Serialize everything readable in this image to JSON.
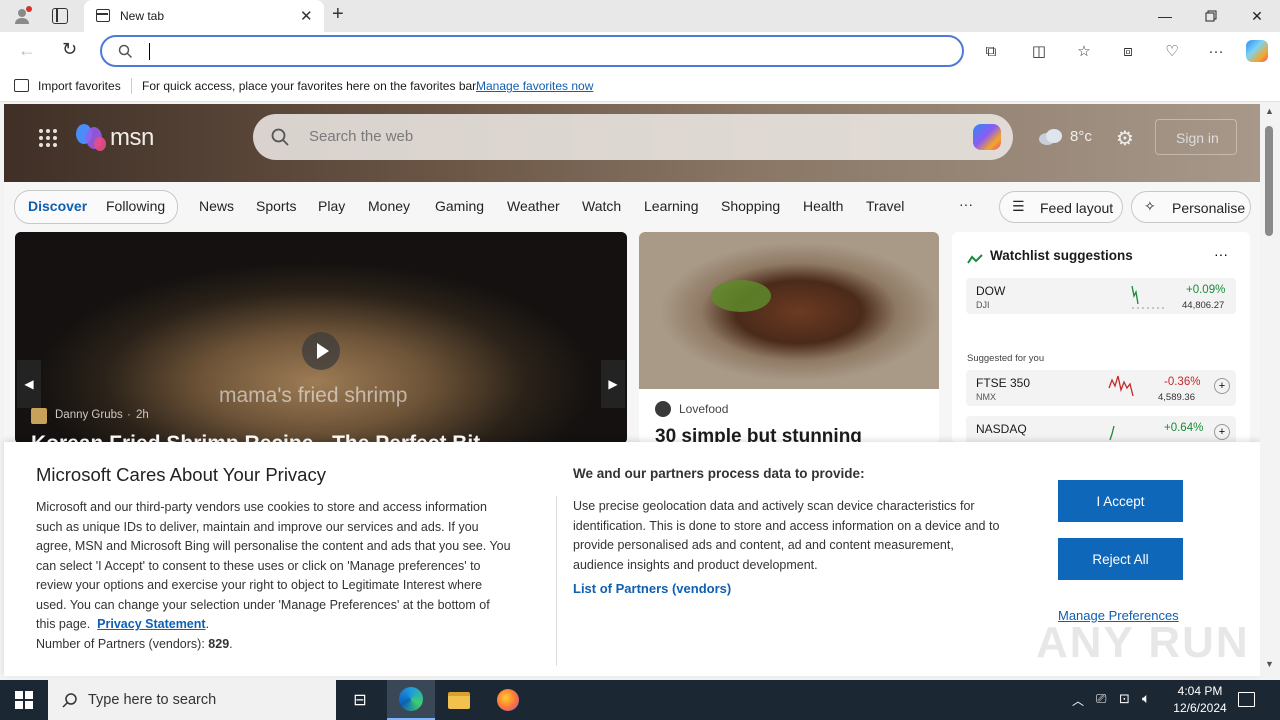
{
  "browser": {
    "tab_title": "New tab",
    "address_value": "",
    "favorites_bar": {
      "import_label": "Import favorites",
      "message": "For quick access, place your favorites here on the favorites bar.",
      "manage_link": "Manage favorites now"
    }
  },
  "msn": {
    "logo": "msn",
    "search_placeholder": "Search the web",
    "temperature": "8°c",
    "sign_in": "Sign in",
    "tabs": [
      "Discover",
      "Following"
    ],
    "nav": [
      "News",
      "Sports",
      "Play",
      "Money",
      "Gaming",
      "Weather",
      "Watch",
      "Learning",
      "Shopping",
      "Health",
      "Travel"
    ],
    "more": "···",
    "feed_layout": "Feed layout",
    "personalise": "Personalise",
    "hero": {
      "overlay_text": "mama's fried shrimp",
      "author": "Danny Grubs",
      "age": "2h",
      "headline": "Korean Fried Shrimp Recipe - The Perfect Bit"
    },
    "food_card": {
      "source": "Lovefood",
      "headline": "30 simple but stunning"
    },
    "watchlist": {
      "title": "Watchlist suggestions",
      "menu": "···",
      "suggested_label": "Suggested for you",
      "items": [
        {
          "name": "DOW",
          "sub": "DJI",
          "change": "+0.09%",
          "value": "44,806.27",
          "color": "#1a8a3a"
        },
        {
          "name": "FTSE 350",
          "sub": "NMX",
          "change": "-0.36%",
          "value": "4,589.36",
          "color": "#c62828"
        },
        {
          "name": "NASDAQ",
          "sub": "",
          "change": "+0.64%",
          "value": "",
          "color": "#1a8a3a"
        }
      ]
    }
  },
  "privacy": {
    "title": "Microsoft Cares About Your Privacy",
    "body_lines": [
      "Microsoft and our third-party vendors use cookies to store and access information",
      "such as unique IDs to deliver, maintain and improve our services and ads. If you",
      "agree, MSN and Microsoft Bing will personalise the content and ads that you see. You",
      "can select 'I Accept' to consent to these uses or click on 'Manage preferences' to",
      "review your options and exercise your right to object to Legitimate Interest where",
      "used.  You can change your selection under 'Manage Preferences' at the bottom of"
    ],
    "body_last_prefix": "this page.",
    "privacy_link": "Privacy Statement",
    "partners_label": "Number of Partners (vendors):",
    "partners_count": "829",
    "right_title": "We and our partners process data to provide:",
    "right_lines": [
      "Use precise geolocation data and actively scan device characteristics for",
      "identification. This is done to store and access information on a device and to",
      "provide personalised ads and content, ad and content measurement,",
      "audience insights and product development."
    ],
    "partners_link": "List of Partners (vendors)",
    "accept": "I Accept",
    "reject": "Reject All",
    "manage": "Manage Preferences"
  },
  "taskbar": {
    "search_placeholder": "Type here to search",
    "time": "4:04 PM",
    "date": "12/6/2024"
  },
  "watermark": "ANY RUN"
}
